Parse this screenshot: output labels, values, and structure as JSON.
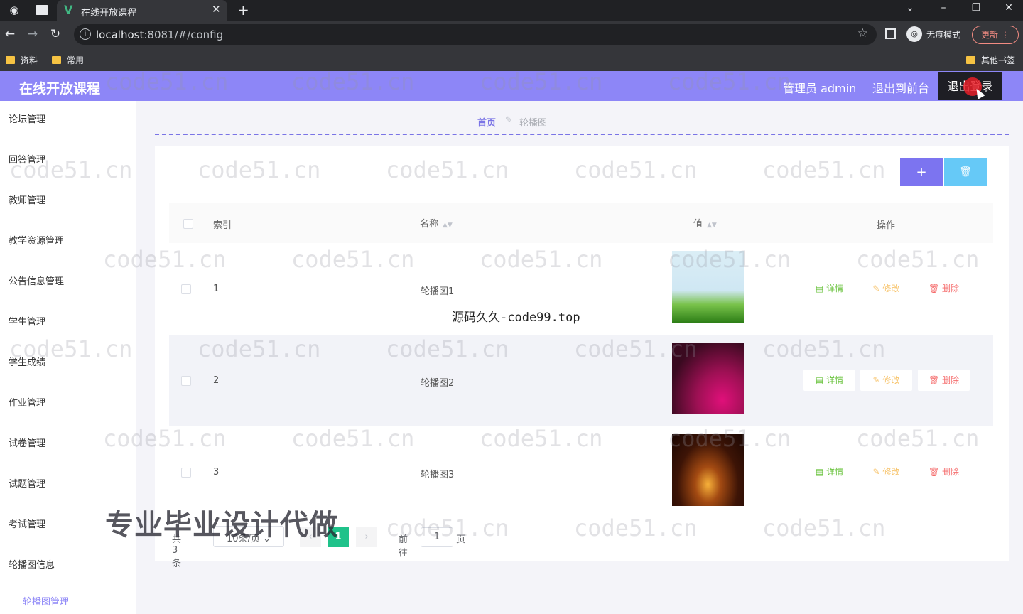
{
  "browser": {
    "tab_title": "在线开放课程",
    "url_host": "localhost",
    "url_rest": ":8081/#/config",
    "incognito_label": "无痕模式",
    "update_label": "更新",
    "bookmarks": [
      "资料",
      "常用"
    ],
    "other_bookmarks": "其他书签"
  },
  "header": {
    "title": "在线开放课程",
    "admin": "管理员 admin",
    "back_front": "退出到前台",
    "logout": "退出登录",
    "color": "#8d86f7"
  },
  "sidebar": {
    "items": [
      "论坛管理",
      "回答管理",
      "教师管理",
      "教学资源管理",
      "公告信息管理",
      "学生管理",
      "学生成绩",
      "作业管理",
      "试卷管理",
      "试题管理",
      "考试管理",
      "轮播图信息"
    ],
    "sub_item": "轮播图管理"
  },
  "breadcrumb": {
    "home": "首页",
    "current": "轮播图"
  },
  "toolbar": {
    "add_icon": "+",
    "delete_icon": "🗑"
  },
  "table": {
    "headers": {
      "index": "索引",
      "name": "名称",
      "value": "值",
      "actions": "操作"
    },
    "rows": [
      {
        "index": "1",
        "name": "轮播图1",
        "image": "green-hill-image"
      },
      {
        "index": "2",
        "name": "轮播图2",
        "image": "pink-flowers-image"
      },
      {
        "index": "3",
        "name": "轮播图3",
        "image": "fire-image"
      }
    ],
    "actions": {
      "detail": "详情",
      "edit": "修改",
      "delete": "删除"
    }
  },
  "pager": {
    "total": "共 3 条",
    "page_size": "10条/页",
    "current": "1",
    "goto": "前往",
    "goto_value": "1",
    "page_unit": "页"
  },
  "watermarks": {
    "site": "code51.cn",
    "source": "源码久久-code99.top",
    "banner": "专业毕业设计代做"
  }
}
